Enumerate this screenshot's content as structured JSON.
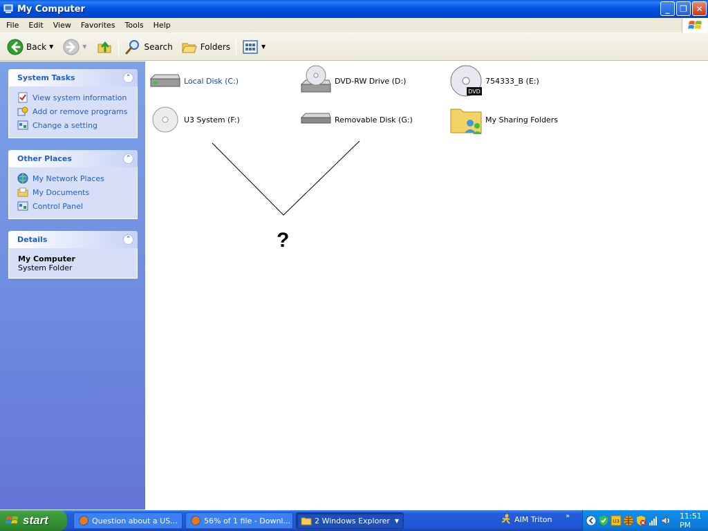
{
  "window": {
    "title": "My Computer"
  },
  "menu": [
    "File",
    "Edit",
    "View",
    "Favorites",
    "Tools",
    "Help"
  ],
  "toolbar": {
    "back": "Back",
    "search": "Search",
    "folders": "Folders"
  },
  "panels": {
    "system_tasks": {
      "title": "System Tasks",
      "items": [
        "View system information",
        "Add or remove programs",
        "Change a setting"
      ]
    },
    "other_places": {
      "title": "Other Places",
      "items": [
        "My Network Places",
        "My Documents",
        "Control Panel"
      ]
    },
    "details": {
      "title": "Details",
      "name": "My Computer",
      "type": "System Folder"
    }
  },
  "drives": [
    {
      "label": "Local Disk (C:)",
      "icon": "hard-disk-icon"
    },
    {
      "label": "DVD-RW Drive (D:)",
      "icon": "dvd-rw-drive-icon"
    },
    {
      "label": "754333_B (E:)",
      "icon": "dvd-disc-icon"
    },
    {
      "label": "U3 System (F:)",
      "icon": "cd-disc-icon"
    },
    {
      "label": "Removable Disk (G:)",
      "icon": "removable-disk-icon"
    },
    {
      "label": "My Sharing Folders",
      "icon": "shared-folder-icon"
    }
  ],
  "annotation": {
    "mark": "?"
  },
  "taskbar": {
    "start": "start",
    "tasks": [
      "Question about a US...",
      "56% of 1 file - Downl...",
      "2 Windows Explorer"
    ],
    "aim": "AIM Triton",
    "clock": "11:51 PM"
  },
  "colors": {
    "title_blue": "#0053e0",
    "task_link": "#215dc6",
    "start_green": "#3c9a3c"
  }
}
